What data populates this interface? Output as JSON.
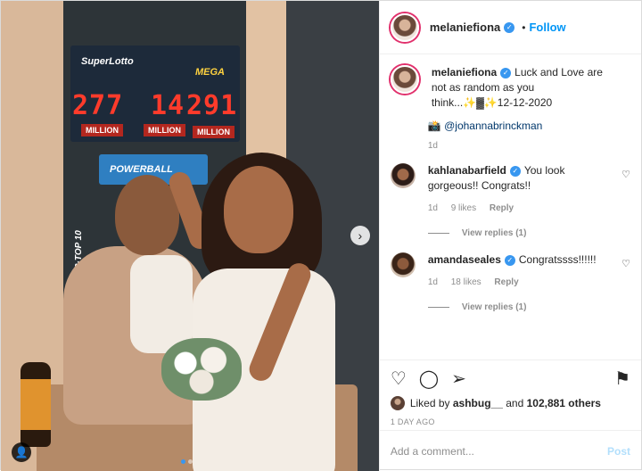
{
  "post": {
    "photo": {
      "signs": {
        "jackpot_1": "277",
        "jackpot_2": "14",
        "jackpot_3": "291",
        "million_1": "MILLION",
        "million_2": "MILLION",
        "million_3": "MILLION",
        "powerball": "POWERBALL",
        "superlotto": "SuperLotto",
        "mega": "MEGA",
        "top": "2·TOP 10"
      },
      "carousel": {
        "dots": 2,
        "active": 1
      }
    },
    "header": {
      "username": "melaniefiona",
      "separator": "•",
      "follow_label": "Follow"
    },
    "caption": {
      "username": "melaniefiona",
      "text": "Luck and Love are not as random as you think...✨▓✨12-12-2020",
      "camera_emoji": "📸",
      "mention": "@johannabrinckman",
      "time": "1d"
    },
    "comments": [
      {
        "username": "kahlanabarfield",
        "text": "You look gorgeous!! Congrats!!",
        "time": "1d",
        "likes": "9 likes",
        "reply_label": "Reply",
        "view_replies": "View replies (1)"
      },
      {
        "username": "amandaseales",
        "text": "Congratssss!!!!!!",
        "time": "1d",
        "likes": "18 likes",
        "reply_label": "Reply",
        "view_replies": "View replies (1)"
      }
    ],
    "likes": {
      "prefix": "Liked by",
      "user": "ashbug__",
      "and": "and",
      "others": "102,881 others"
    },
    "time_ago": "1 DAY AGO",
    "add_comment": {
      "placeholder": "Add a comment...",
      "post_label": "Post"
    },
    "colors": {
      "accent": "#0095f6",
      "verified": "#3897f0",
      "muted": "#8e8e8e",
      "post_disabled": "#b2dffc"
    },
    "icons": {
      "heart": "heart-icon",
      "comment": "comment-icon",
      "share": "share-icon",
      "save": "bookmark-icon",
      "next": "chevron-right-icon",
      "tag": "user-tag-icon"
    }
  }
}
